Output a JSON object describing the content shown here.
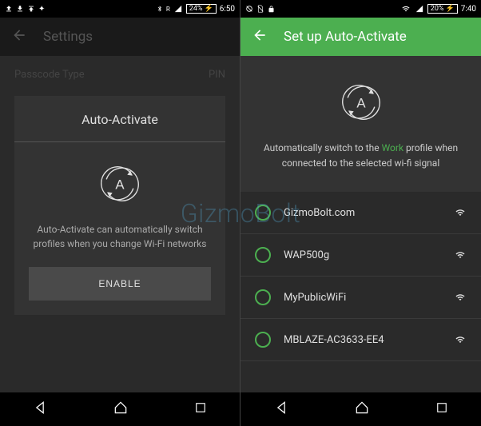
{
  "left": {
    "statusbar": {
      "battery": "24%",
      "time": "6:50"
    },
    "appbar": {
      "title": "Settings"
    },
    "dimrow": {
      "label": "Passcode Type",
      "value": "PIN"
    },
    "card": {
      "title": "Auto-Activate",
      "description": "Auto-Activate can automatically switch profiles when you change Wi-Fi networks",
      "button": "ENABLE"
    }
  },
  "right": {
    "statusbar": {
      "battery": "20%",
      "time": "7:40"
    },
    "appbar": {
      "title": "Set up Auto-Activate"
    },
    "hero": {
      "prefix": "Automatically switch to the ",
      "profile": "Work",
      "suffix": " profile when connected to the selected wi-fi signal"
    },
    "wifi": [
      {
        "name": "GizmoBolt.com"
      },
      {
        "name": "WAP500g"
      },
      {
        "name": "MyPublicWiFi"
      },
      {
        "name": "MBLAZE-AC3633-EE4"
      }
    ]
  },
  "watermark": "GizmoBolt"
}
